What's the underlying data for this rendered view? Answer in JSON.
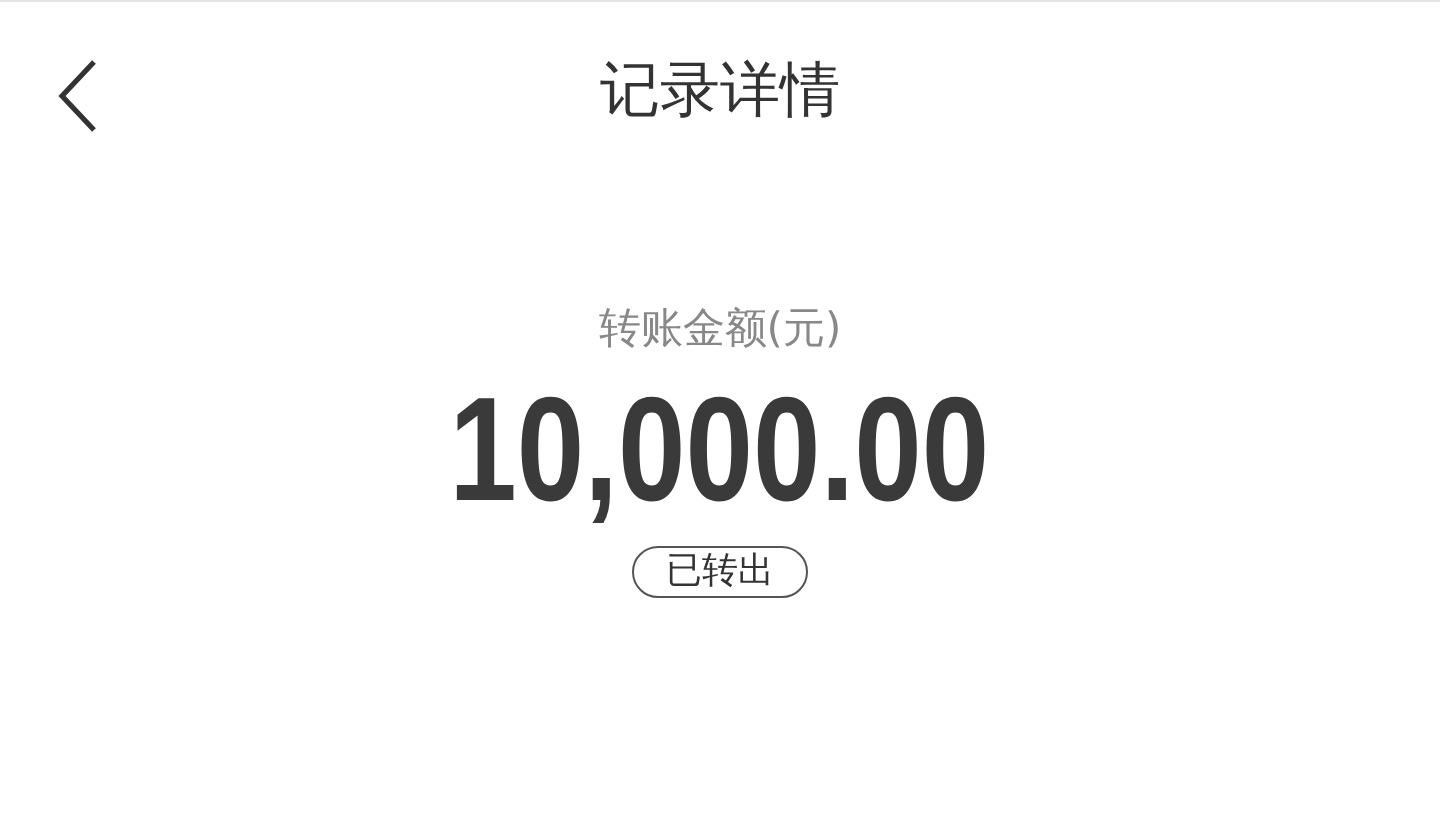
{
  "header": {
    "title": "记录详情"
  },
  "amount_label": "转账金额(元)",
  "amount": "10,000.00",
  "status": "已转出"
}
